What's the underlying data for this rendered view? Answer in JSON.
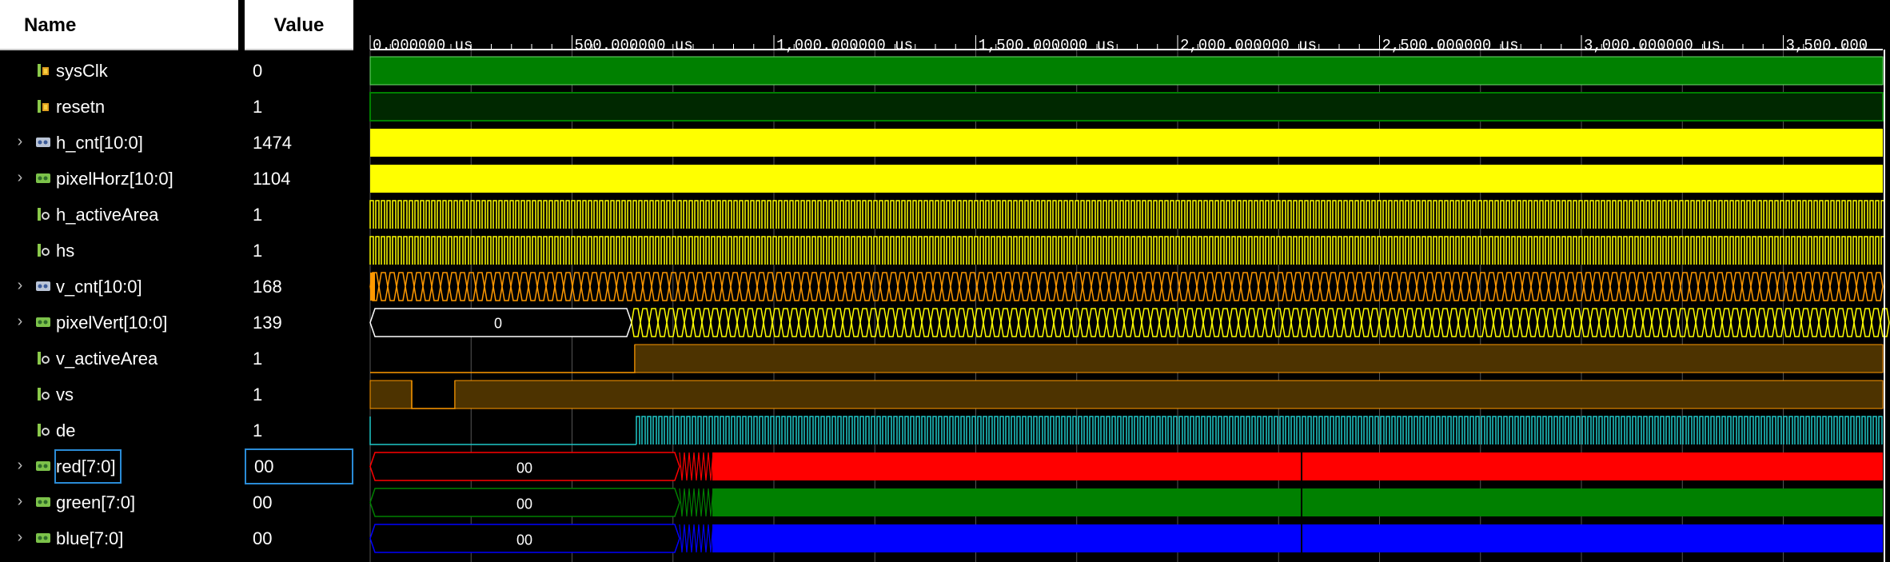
{
  "columns": {
    "name": "Name",
    "value": "Value"
  },
  "colors": {
    "green": "#008000",
    "dark_green": "#002800",
    "yellow": "#ffff00",
    "orange": "#ff9900",
    "brown": "#4d3300",
    "cyan": "#1fc8c8",
    "red": "#ff0000",
    "blue": "#0000ff",
    "grid": "#555555",
    "selection": "#2a8bd6"
  },
  "timeline": {
    "unit": "us",
    "labels": [
      "0.000000 us",
      "500.000000 us",
      "1,000.000000 us",
      "1,500.000000 us",
      "2,000.000000 us",
      "2,500.000000 us",
      "3,000.000000 us",
      "3,500.000"
    ]
  },
  "signals": [
    {
      "name": "sysClk",
      "value": "0",
      "expandable": false,
      "icon": "clock-signal-icon",
      "wave": "clk"
    },
    {
      "name": "resetn",
      "value": "1",
      "expandable": false,
      "icon": "clock-signal-icon",
      "wave": "high-dark"
    },
    {
      "name": "h_cnt[10:0]",
      "value": "1474",
      "expandable": true,
      "icon": "bus-signal-icon",
      "wave": "bus-yellow"
    },
    {
      "name": "pixelHorz[10:0]",
      "value": "1104",
      "expandable": true,
      "icon": "bus-output-icon",
      "wave": "bus-yellow"
    },
    {
      "name": "h_activeArea",
      "value": "1",
      "expandable": false,
      "icon": "output-signal-icon",
      "wave": "toggle-yellow"
    },
    {
      "name": "hs",
      "value": "1",
      "expandable": false,
      "icon": "output-signal-icon",
      "wave": "toggle-yellow"
    },
    {
      "name": "v_cnt[10:0]",
      "value": "168",
      "expandable": true,
      "icon": "bus-signal-icon",
      "wave": "bus-orange"
    },
    {
      "name": "pixelVert[10:0]",
      "value": "139",
      "expandable": true,
      "icon": "bus-output-icon",
      "wave": "bus-zero-then-yellow",
      "bus_label": "0"
    },
    {
      "name": "v_activeArea",
      "value": "1",
      "expandable": false,
      "icon": "output-signal-icon",
      "wave": "step-brown"
    },
    {
      "name": "vs",
      "value": "1",
      "expandable": false,
      "icon": "output-signal-icon",
      "wave": "vs-brown"
    },
    {
      "name": "de",
      "value": "1",
      "expandable": false,
      "icon": "output-signal-icon",
      "wave": "toggle-cyan"
    },
    {
      "name": "red[7:0]",
      "value": "00",
      "expandable": true,
      "icon": "bus-output-icon",
      "wave": "color-bus",
      "bus_label": "00",
      "fill": "#ff0000",
      "selected": true
    },
    {
      "name": "green[7:0]",
      "value": "00",
      "expandable": true,
      "icon": "bus-output-icon",
      "wave": "color-bus",
      "bus_label": "00",
      "fill": "#008000"
    },
    {
      "name": "blue[7:0]",
      "value": "00",
      "expandable": true,
      "icon": "bus-output-icon",
      "wave": "color-bus",
      "bus_label": "00",
      "fill": "#0000ff"
    }
  ]
}
